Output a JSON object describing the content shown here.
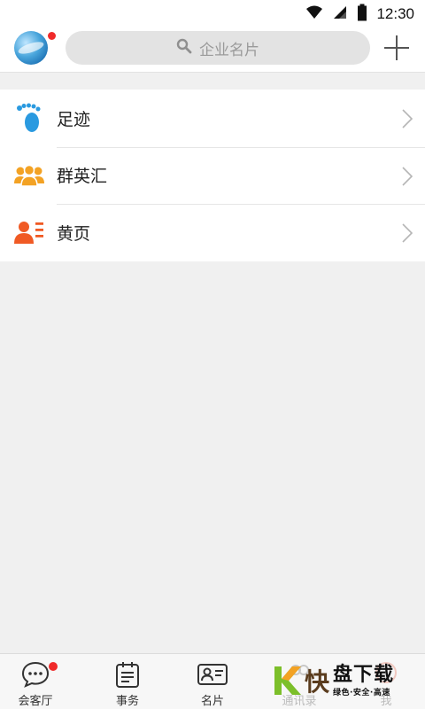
{
  "status_bar": {
    "time": "12:30"
  },
  "header": {
    "search_placeholder": "企业名片"
  },
  "menu": [
    {
      "label": "足迹",
      "icon": "footprint-icon",
      "color": "#2a9ae0"
    },
    {
      "label": "群英汇",
      "icon": "group-icon",
      "color": "#f3a224"
    },
    {
      "label": "黄页",
      "icon": "contact-card-icon",
      "color": "#f05a24"
    }
  ],
  "bottom_nav": [
    {
      "label": "会客厅",
      "icon": "chat-bubble-icon",
      "badge": true
    },
    {
      "label": "事务",
      "icon": "notepad-icon"
    },
    {
      "label": "名片",
      "icon": "business-card-icon"
    },
    {
      "label": "通讯录",
      "icon": "contacts-icon"
    },
    {
      "label": "我",
      "icon": "profile-icon"
    }
  ],
  "watermark": {
    "brand": "快",
    "title": "盘下载",
    "subtitle": "绿色·安全·高速"
  },
  "colors": {
    "badge": "#f02a2a",
    "background": "#f0f0f0",
    "search_bg": "#e3e3e3"
  }
}
